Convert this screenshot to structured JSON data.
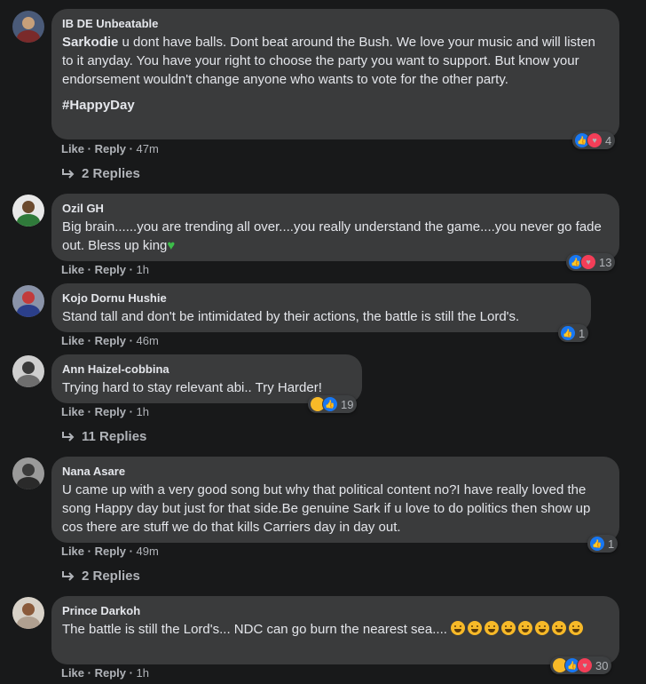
{
  "comments": [
    {
      "name": "IB DE Unbeatable",
      "mention": "Sarkodie",
      "text": " u dont have balls. Dont beat around the Bush. We love your music and will listen to it anyday. You have your right to choose the party you want to support. But know your endorsement wouldn't change anyone who wants to vote for the other party.",
      "hashtag": "#HappyDay",
      "like": "Like",
      "reply": "Reply",
      "time": "47m",
      "reaction_count": "4",
      "replies": "2 Replies"
    },
    {
      "name": "Ozil GH",
      "text": "Big brain......you are trending all over....you really understand the game....you never go fade out. Bless up king",
      "like": "Like",
      "reply": "Reply",
      "time": "1h",
      "reaction_count": "13"
    },
    {
      "name": "Kojo Dornu Hushie",
      "text": "Stand tall and don't be intimidated by their actions, the battle is still the Lord's.",
      "like": "Like",
      "reply": "Reply",
      "time": "46m",
      "reaction_count": "1"
    },
    {
      "name": "Ann Haizel-cobbina",
      "text": "Trying hard to stay relevant abi.. Try Harder!",
      "like": "Like",
      "reply": "Reply",
      "time": "1h",
      "reaction_count": "19",
      "replies": "11 Replies"
    },
    {
      "name": "Nana Asare",
      "text": "U came up with a very good song but why that political content no?I have really loved the song Happy day but just for that side.Be genuine Sark if u love to do politics then show up cos there are stuff we do that kills Carriers day in day out.",
      "like": "Like",
      "reply": "Reply",
      "time": "49m",
      "reaction_count": "1",
      "replies": "2 Replies"
    },
    {
      "name": "Prince Darkoh",
      "text": "The battle is still the Lord's... NDC can go burn the nearest sea....",
      "like": "Like",
      "reply": "Reply",
      "time": "1h",
      "reaction_count": "30"
    }
  ],
  "colors": {
    "background": "#18191a",
    "bubble": "#3a3b3c",
    "secondary_text": "#b0b3b8",
    "like_blue": "#1877f2",
    "love_red": "#f33e58",
    "haha_yellow": "#f7b928"
  }
}
